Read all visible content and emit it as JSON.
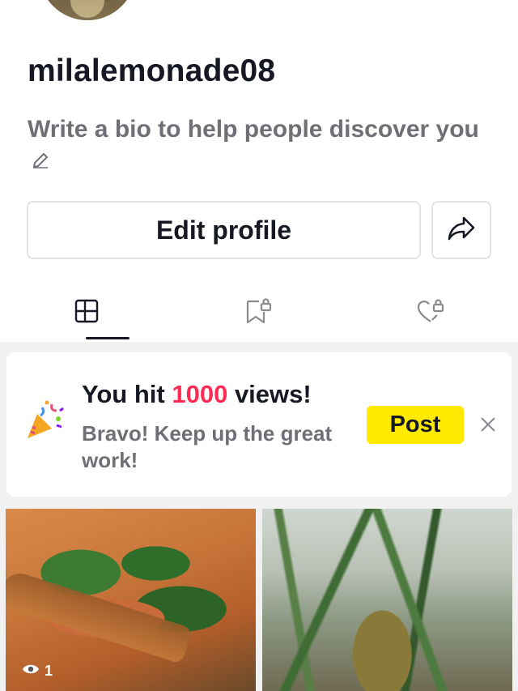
{
  "profile": {
    "username": "milalemonade08",
    "bio_placeholder": "Write a bio to help people discover you"
  },
  "actions": {
    "edit_profile_label": "Edit profile"
  },
  "tabs": [
    {
      "icon": "grid-icon"
    },
    {
      "icon": "bookmark-lock-icon"
    },
    {
      "icon": "heart-lock-icon"
    }
  ],
  "milestone_card": {
    "title_prefix": "You hit ",
    "title_highlight": "1000",
    "title_suffix": " views!",
    "subtitle": "Bravo! Keep up the great work!",
    "post_label": "Post"
  },
  "videos": [
    {
      "views": "1"
    },
    {
      "views": ""
    }
  ],
  "colors": {
    "highlight": "#fe2c55",
    "post_button": "#ffea00",
    "text_primary": "#161823",
    "text_secondary": "#6f7075"
  }
}
